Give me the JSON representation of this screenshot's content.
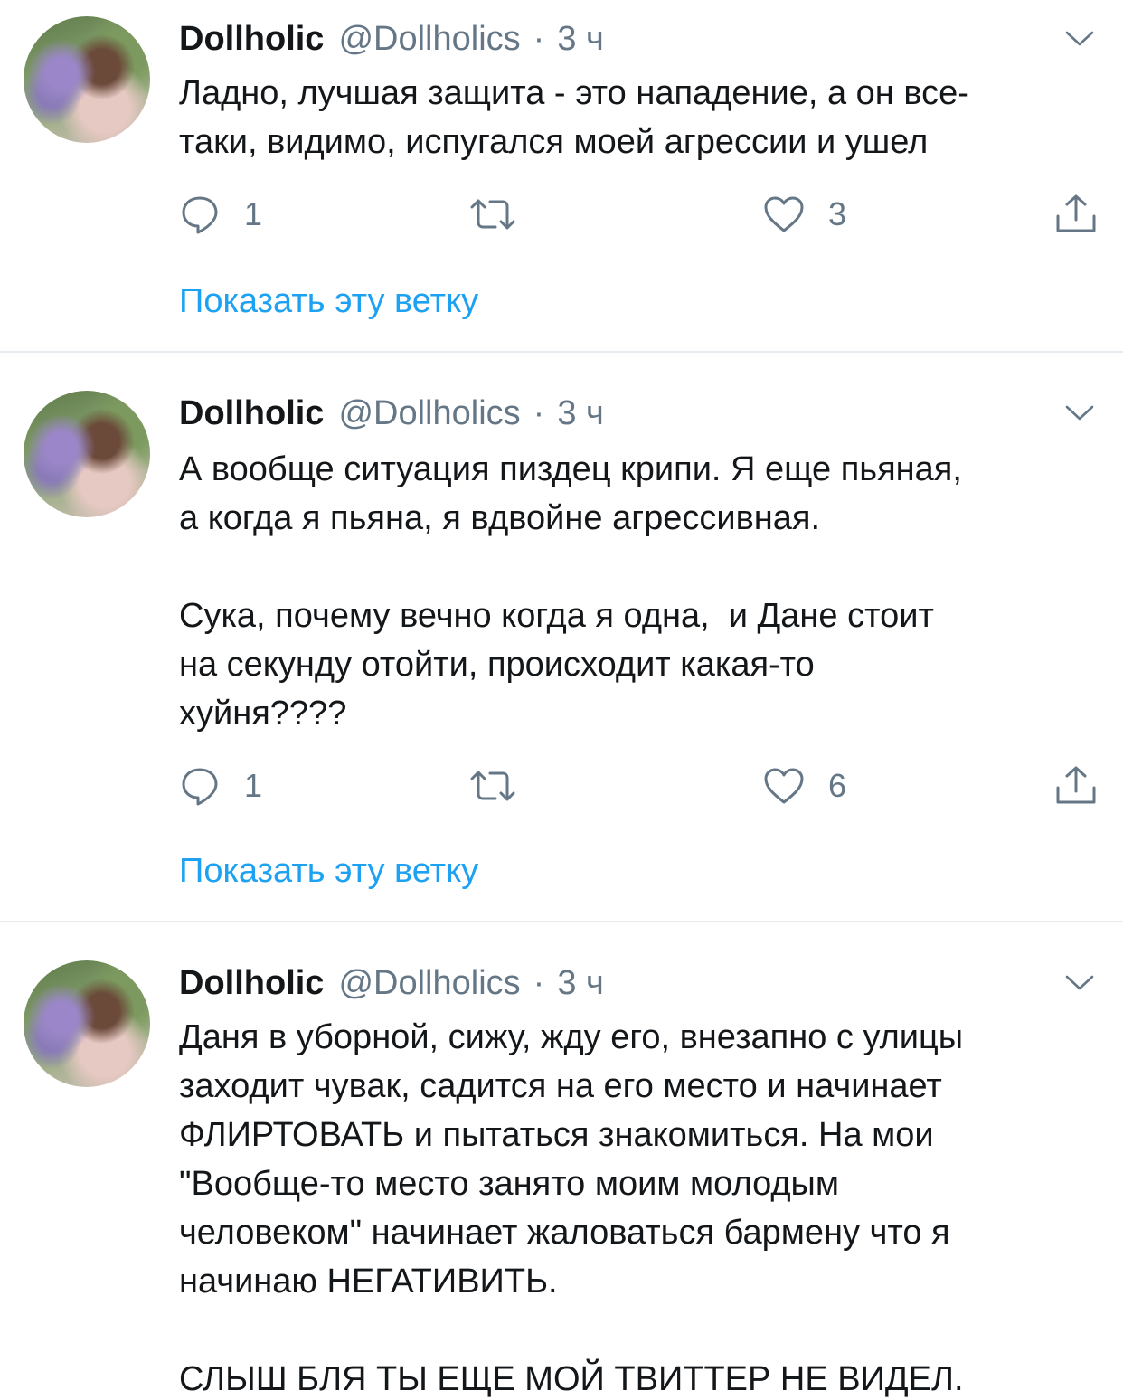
{
  "colors": {
    "accent": "#1da1f2",
    "muted": "#657786",
    "text": "#14171a",
    "divider": "#e6ecf0"
  },
  "tweets": [
    {
      "name": "Dollholic",
      "handle": "@Dollholics",
      "separator": "·",
      "time": "3 ч",
      "text": "Ладно, лучшая защита - это нападение, а он все-\nтаки, видимо, испугался моей агрессии и ушел",
      "replies": "1",
      "likes": "3",
      "show_thread": "Показать эту ветку"
    },
    {
      "name": "Dollholic",
      "handle": "@Dollholics",
      "separator": "·",
      "time": "3 ч",
      "text": "А вообще ситуация пиздец крипи. Я еще пьяная,\nа когда я пьяна, я вдвойне агрессивная.\n\nСука, почему вечно когда я одна,  и Дане стоит\nна секунду отойти, происходит какая-то\nхуйня????",
      "replies": "1",
      "likes": "6",
      "show_thread": "Показать эту ветку"
    },
    {
      "name": "Dollholic",
      "handle": "@Dollholics",
      "separator": "·",
      "time": "3 ч",
      "text": "Даня в уборной, сижу, жду его, внезапно с улицы\nзаходит чувак, садится на его место и начинает\nФЛИРТОВАТЬ и пытаться знакомиться. На мои\n\"Вообще-то место занято моим молодым\nчеловеком\" начинает жаловаться бармену что я\nначинаю НЕГАТИВИТЬ.\n\nСЛЫШ БЛЯ ТЫ ЕЩЕ МОЙ ТВИТТЕР НЕ ВИДЕЛ."
    }
  ]
}
